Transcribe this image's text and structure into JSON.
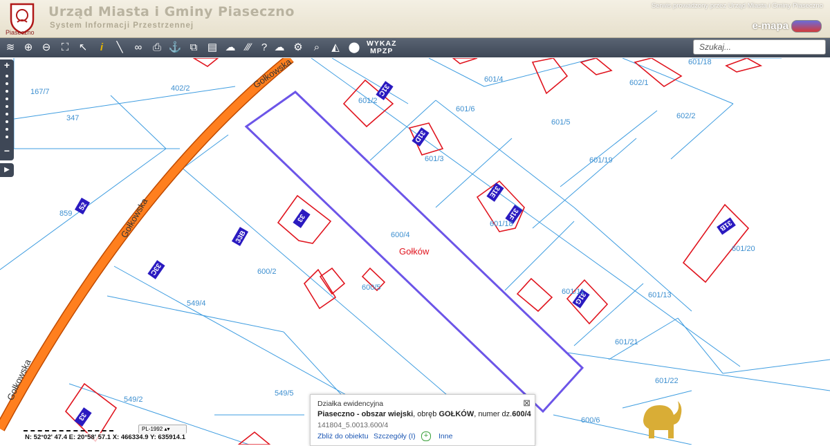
{
  "header": {
    "title": "Urząd Miasta i Gminy Piaseczno",
    "subtitle": "System Informacji Przestrzennej",
    "crest_label": "Piaseczno",
    "service_note": "Serwis prowadzony przez Urząd Miasta i Gminy Piaseczno",
    "brand": "e-mapa"
  },
  "toolbar": {
    "tools": [
      "layers-icon",
      "zoom-in-icon",
      "zoom-out-icon",
      "zoom-extent-icon",
      "pointer-icon",
      "info-icon",
      "measure-icon",
      "link-icon",
      "print-icon",
      "anchor-icon",
      "copy-icon",
      "layout-icon",
      "shape-icon",
      "hatch-icon",
      "help-icon",
      "cloud-icon",
      "settings-icon",
      "search-map-icon",
      "warning-icon",
      "marker-icon"
    ],
    "wykaz_label_1": "WYKAZ",
    "wykaz_label_2": "MPZP",
    "search_placeholder": "Szukaj..."
  },
  "map": {
    "streets": [
      "Gołkowska",
      "Gołkowska",
      "Gołkowska"
    ],
    "locality": "Gołków",
    "parcels": [
      "167/7",
      "402/2",
      "347",
      "859",
      "549/4",
      "549/5",
      "549/2",
      "600/2",
      "600/4",
      "600/5",
      "600/6",
      "601/2",
      "601/4",
      "601/6",
      "601/3",
      "601/5",
      "601/19",
      "601/18",
      "601/18",
      "602/1",
      "602/2",
      "601/20",
      "601/13",
      "601/21",
      "601/22",
      "601/11"
    ],
    "buildings": [
      "31C",
      "31D",
      "31E",
      "31F",
      "31G",
      "31B",
      "33",
      "33B",
      "33C",
      "52",
      "33"
    ]
  },
  "popup": {
    "title": "Działka ewidencyjna",
    "desc_pre": "Piaseczno - obszar wiejski",
    "desc_mid": ", obręb ",
    "desc_obreb": "GOŁKÓW",
    "desc_mid2": ", numer dz.",
    "desc_num": "600/4",
    "id": "141804_5.0013.600/4",
    "link_zoom": "Zbliż do obiektu",
    "link_details": "Szczegóły (I)",
    "link_other": "Inne"
  },
  "status": {
    "coords": "N: 52°02' 47.4   E: 20°58' 57.1   X: 466334.9   Y: 635914.1",
    "crs": "PL-1992"
  }
}
